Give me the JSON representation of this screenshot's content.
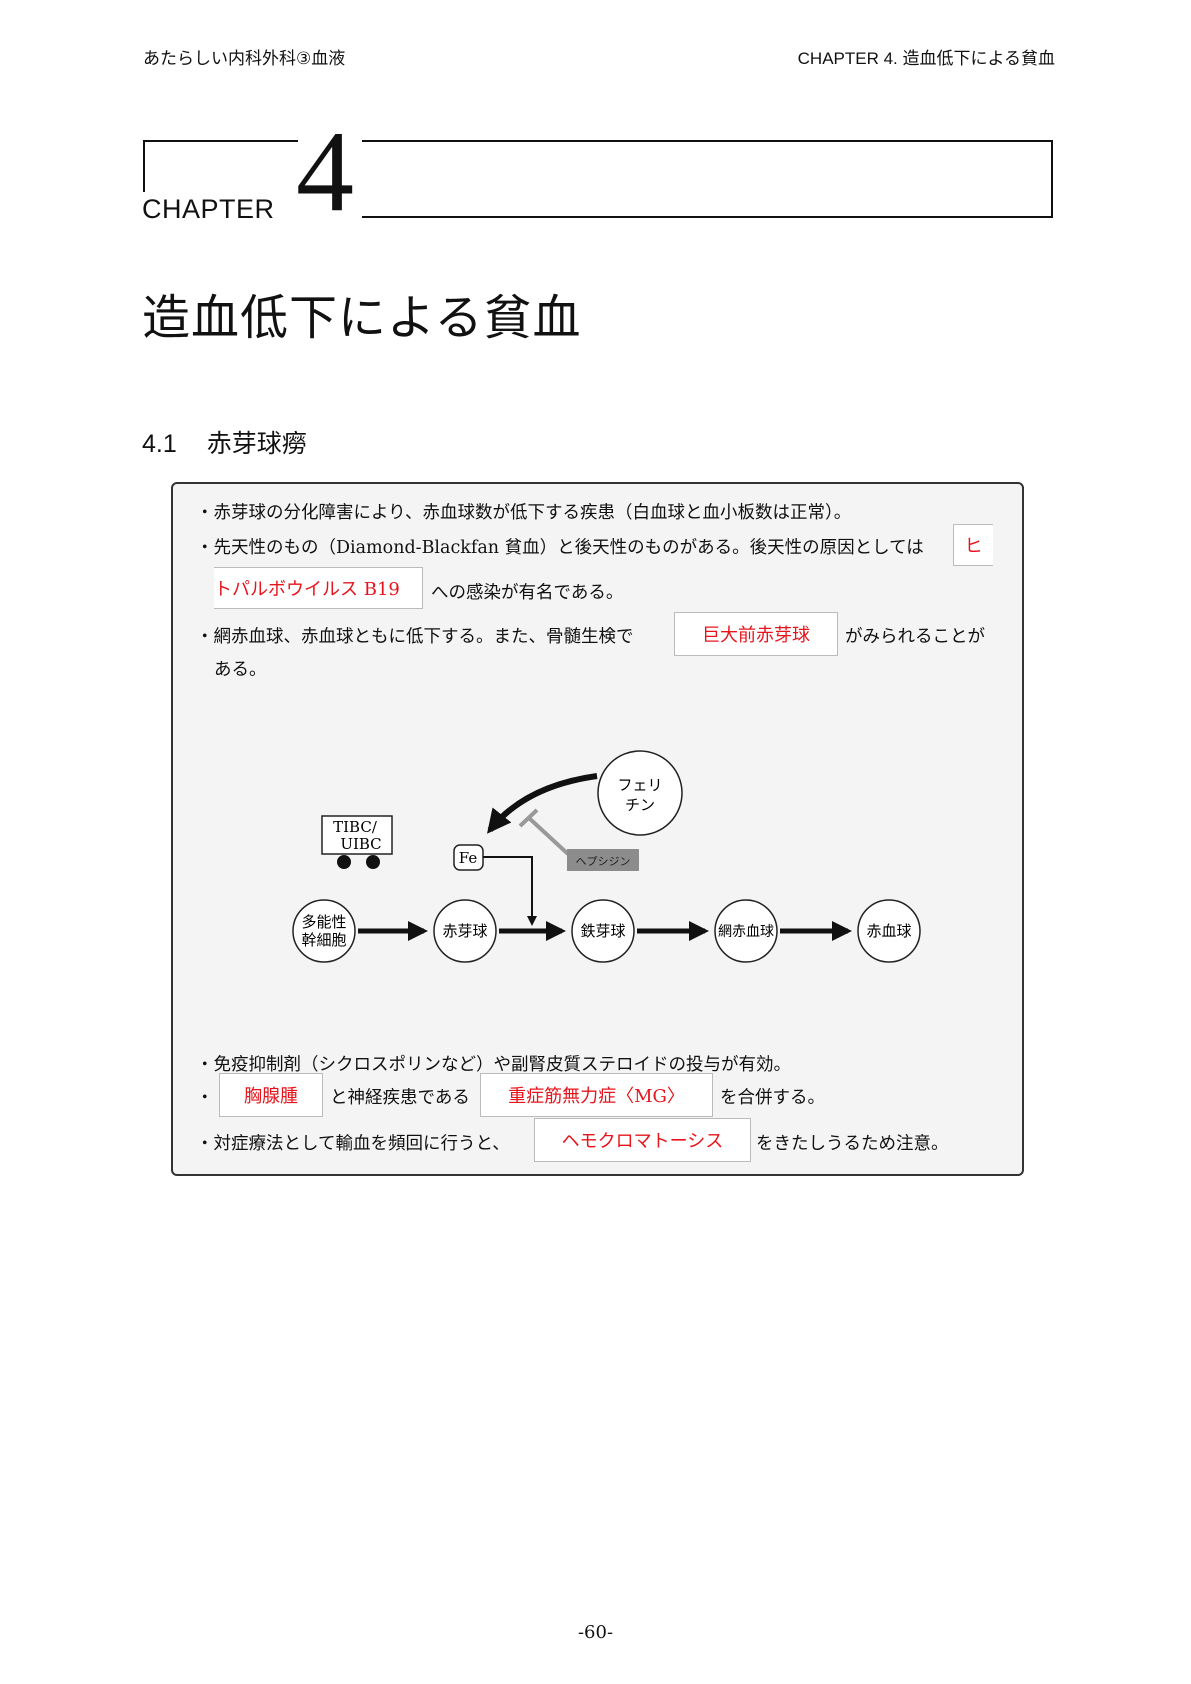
{
  "header": {
    "left": "あたらしい内科外科③血液",
    "right": "CHAPTER  4.  造血低下による貧血"
  },
  "chapter": {
    "label": "CHAPTER",
    "number": "4",
    "title": "造血低下による貧血"
  },
  "section": {
    "number": "4.1",
    "title": "赤芽球癆"
  },
  "summary": {
    "line1": "・赤芽球の分化障害により、赤血球数が低下する疾患（白血球と血小板数は正常）。",
    "line2_text": "・先天性のもの（Diamond-Blackfan 貧血）と後天性のものがある。後天性の原因としては",
    "line2_blank_part1": "ヒ",
    "line3_blank_part2": "トパルボウイルス B19",
    "line3_text": "への感染が有名である。",
    "line4_text_a": "・網赤血球、赤血球ともに低下する。また、骨髄生検で",
    "line4_blank": "巨大前赤芽球",
    "line4_text_b": "がみられることが",
    "line5_text": "ある。",
    "line6": "・免疫抑制剤（シクロスポリンなど）や副腎皮質ステロイドの投与が有効。",
    "line7_bullet": "・",
    "line7_blank_a": "胸腺腫",
    "line7_text_a": "と神経疾患である",
    "line7_blank_b": "重症筋無力症〈MG〉",
    "line7_text_b": "を合併する。",
    "line8_text_a": "・対症療法として輸血を頻回に行うと、",
    "line8_blank": "ヘモクロマトーシス",
    "line8_text_b": "をきたしうるため注意。"
  },
  "diagram": {
    "nodes": [
      "多能性",
      "幹細胞",
      "赤芽球",
      "鉄芽球",
      "網赤血球",
      "赤血球"
    ],
    "ferritin": [
      "フェリ",
      "チン"
    ],
    "tibc": [
      "TIBC/",
      "UIBC"
    ],
    "fe": "Fe",
    "hepcidin": "ヘプシジン"
  },
  "footer": {
    "page": "-60-"
  }
}
